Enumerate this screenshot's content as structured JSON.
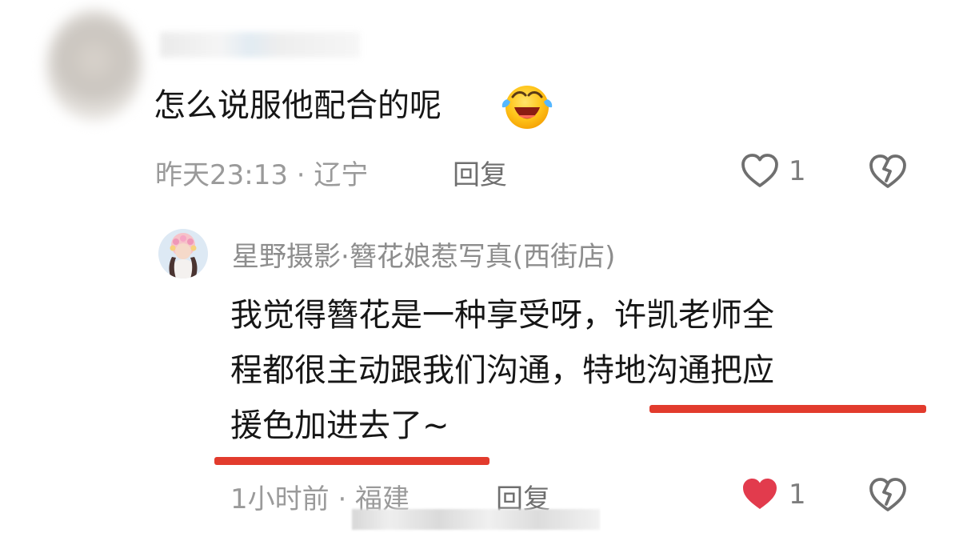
{
  "top_comment": {
    "text": "怎么说服他配合的呢",
    "emoji": "laughing-crying-emoji",
    "meta": "昨天23:13 · 辽宁",
    "reply_label": "回复",
    "like_count": "1",
    "colors": {
      "like_outline": "#6f6f6f",
      "dislike_outline": "#6f6f6f"
    }
  },
  "reply_comment": {
    "author": "星野摄影·簪花娘惹写真(西街店)",
    "text_lines": [
      "我觉得簪花是一种享受呀，许凯老师全",
      "程都很主动跟我们沟通，特地沟通把应",
      "援色加进去了~"
    ],
    "meta": "1小时前 · 福建",
    "reply_label": "回复",
    "like_count": "1",
    "colors": {
      "like_fill": "#e23b4d",
      "underline": "#e23b2d"
    }
  }
}
